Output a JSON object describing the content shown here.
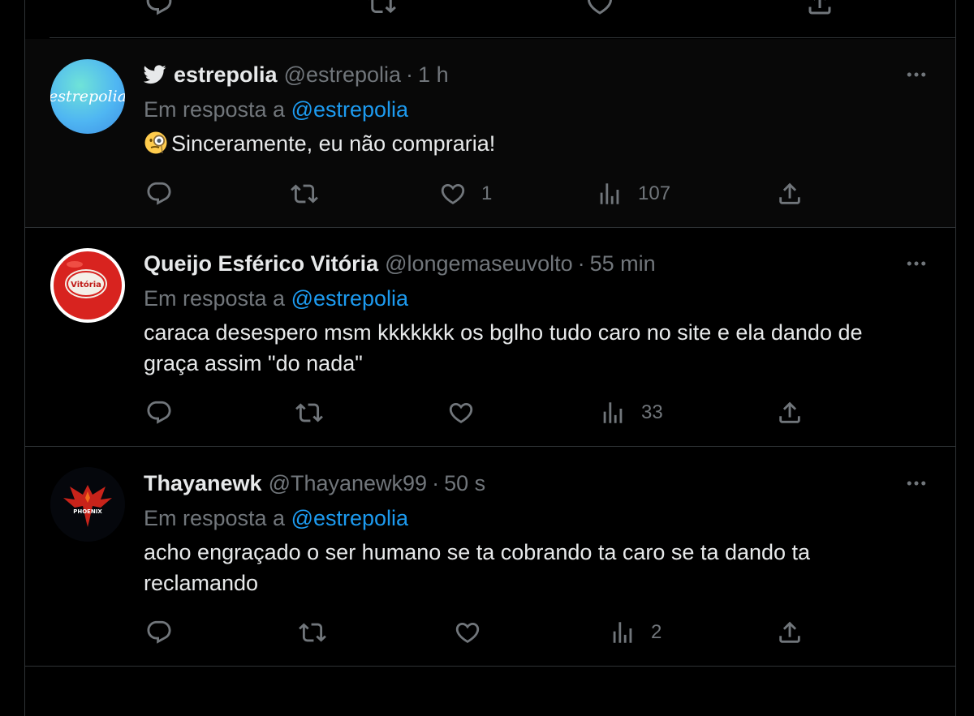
{
  "tweets": [
    {
      "name": "estrepolia",
      "handle": "@estrepolia",
      "time": "1 h",
      "reply_prefix": "Em resposta a",
      "reply_to": "@estrepolia",
      "avatar_text": "estrepolia",
      "emoji": "face-with-monocle",
      "text": "Sinceramente, eu não compraria!",
      "likes": "1",
      "views": "107"
    },
    {
      "name": "Queijo Esférico Vitória",
      "handle": "@longemaseuvolto",
      "time": "55 min",
      "reply_prefix": "Em resposta a",
      "reply_to": "@estrepolia",
      "avatar_text": "Vitória",
      "text": "caraca desespero msm kkkkkkk os bglho tudo caro no site e ela dando de\ngraça assim \"do nada\"",
      "views": "33"
    },
    {
      "name": "Thayanewk",
      "handle": "@Thayanewk99",
      "time": "50 s",
      "reply_prefix": "Em resposta a",
      "reply_to": "@estrepolia",
      "avatar_text": "PHOENIX",
      "text": "acho engraçado o ser humano se ta cobrando ta caro se ta dando ta\nreclamando",
      "views": "2"
    }
  ],
  "colors": {
    "background": "#000000",
    "text": "#e7e9ea",
    "muted": "#71767b",
    "link": "#1d9bf0",
    "border": "#2f3336"
  },
  "icons": [
    "reply-icon",
    "retweet-icon",
    "like-icon",
    "views-icon",
    "share-icon",
    "more-icon",
    "twitter-bird-icon"
  ]
}
